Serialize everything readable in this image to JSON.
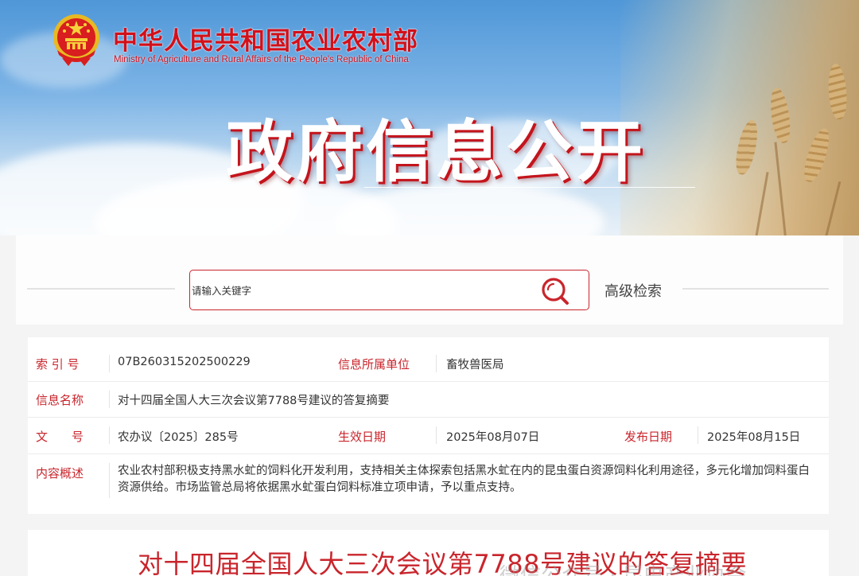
{
  "header": {
    "site_title_cn": "中华人民共和国农业农村部",
    "site_title_en": "Ministry of Agriculture and Rural Affairs of the People's Republic of China",
    "hero_title": "政府信息公开",
    "emblem_icon": "national-emblem-icon"
  },
  "search": {
    "placeholder": "请输入关键字",
    "button_icon": "search-icon",
    "advanced_label": "高级检索"
  },
  "info": {
    "index_label": "索 引 号",
    "index_value": "07B260315202500229",
    "unit_label": "信息所属单位",
    "unit_value": "畜牧兽医局",
    "name_label": "信息名称",
    "name_value": "对十四届全国人大三次会议第7788号建议的答复摘要",
    "doc_label": "文　　号",
    "doc_value": "农办议〔2025〕285号",
    "effective_label": "生效日期",
    "effective_value": "2025年08月07日",
    "publish_label": "发布日期",
    "publish_value": "2025年08月15日",
    "summary_label": "内容概述",
    "summary_value": "农业农村部积极支持黑水虻的饲料化开发利用，支持相关主体探索包括黑水虻在内的昆虫蛋白资源饲料化利用途径，多元化增加饲料蛋白资源供给。市场监管总局将依据黑水虻蛋白饲料标准立项申请，予以重点支持。"
  },
  "article": {
    "title": "对十四届全国人大三次会议第7788号建议的答复摘要"
  },
  "watermark": {
    "text": "微信公众号 · 昆虫产业协会"
  },
  "colors": {
    "accent_red": "#c9252c",
    "title_red": "#d2101a",
    "text": "#333333"
  }
}
